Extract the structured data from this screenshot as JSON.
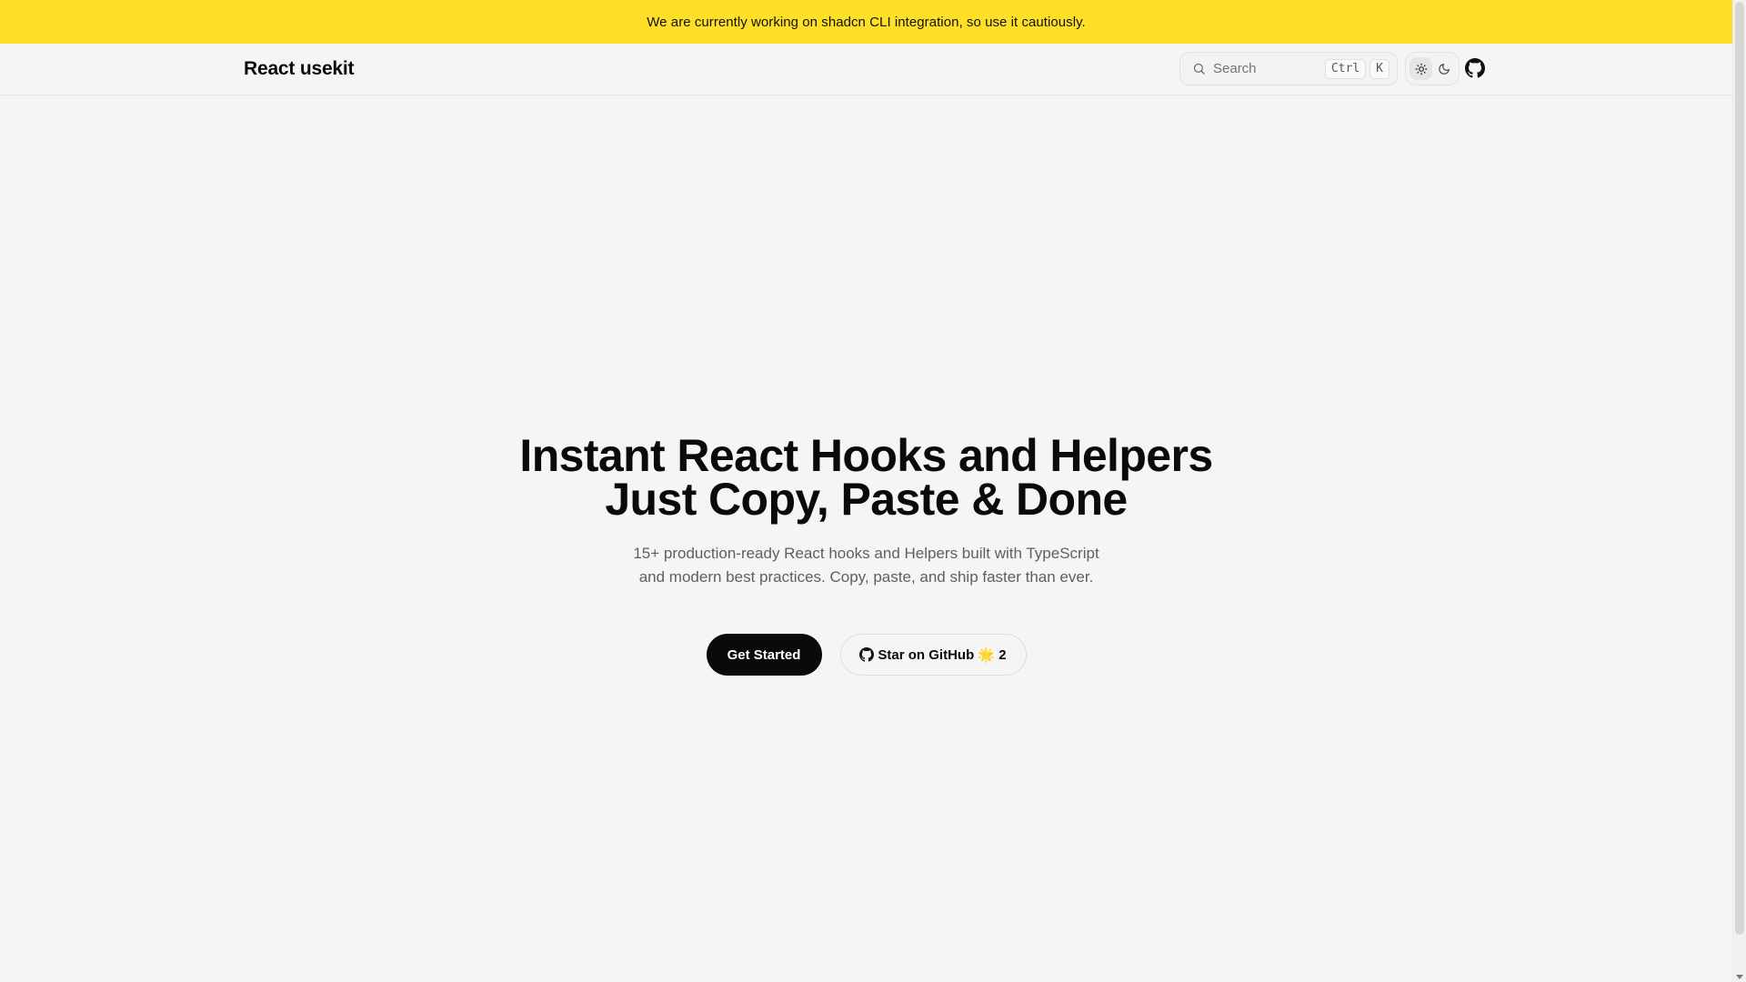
{
  "banner": {
    "text": "We are currently working on shadcn CLI integration, so use it cautiously."
  },
  "header": {
    "brand": "React usekit",
    "search": {
      "placeholder": "Search",
      "shortcut_keys": [
        "Ctrl",
        "K"
      ]
    },
    "theme": {
      "active": "light",
      "icons": [
        "sun-icon",
        "moon-icon"
      ]
    },
    "github_icon": "github-icon"
  },
  "hero": {
    "title_lines": [
      "Instant React Hooks and Helpers",
      "Just Copy, Paste & Done"
    ],
    "subtitle_lines": [
      "15+ production-ready React hooks and Helpers built with TypeScript",
      "and modern best practices. Copy, paste, and ship faster than ever."
    ],
    "primary_cta": "Get Started",
    "secondary_cta": "Star on GitHub 🌟 2"
  },
  "colors": {
    "banner_bg": "#ffe026",
    "page_bg": "#f5f5f5",
    "primary": "#0a0a0a"
  }
}
